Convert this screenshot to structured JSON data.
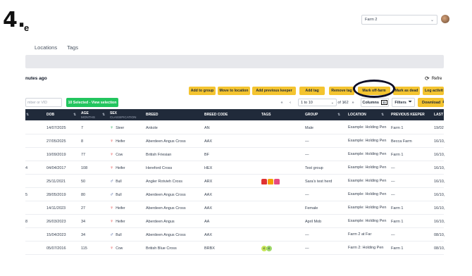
{
  "step": {
    "number": "4.",
    "title_fragment": "e"
  },
  "header": {
    "farm_select": "Farm 2"
  },
  "tabs": [
    "Locations",
    "Tags"
  ],
  "status": {
    "updated_text": "nutes ago",
    "refresh_label": "Refre"
  },
  "actions": {
    "add_to_group": "Add to group",
    "move_to_location": "Move to location",
    "add_previous_keeper": "Add previous keeper",
    "add_tag": "Add tag",
    "remove_tag": "Remove tag",
    "mark_off_farm": "Mark off-farm",
    "mark_as_dead": "Mark as dead",
    "log_activity": "Log activit"
  },
  "toolbar": {
    "search_placeholder": "mber or VID",
    "selection": "10 Selected - View selection",
    "first": "«",
    "prev": "‹",
    "page_range": "1 to 10",
    "page_of": "of 162",
    "next": "›",
    "last": "»",
    "columns": "Columns",
    "columns_badge": "11",
    "filters": "Filters",
    "download": "Download"
  },
  "table": {
    "headers": {
      "dob": "DOB",
      "age": "AGE",
      "age_sub": "MONTHS",
      "sex": "SEX",
      "sex_sub": "CLASSIFICATION",
      "breed": "BREED",
      "breed_code": "BREED CODE",
      "tags": "TAGS",
      "group": "GROUP",
      "location": "LOCATION",
      "previous_keeper": "PREVIOUS KEEPER",
      "last": "LAST"
    },
    "rows": [
      {
        "left": "",
        "dob": "14/07/2025",
        "age": "7",
        "sex": "Steer",
        "sex_type": "female",
        "breed": "Ankole",
        "code": "AN",
        "tags": [],
        "group": "Male",
        "location": "Example: Holding Pen",
        "keeper": "Farm 1",
        "last": "19/02"
      },
      {
        "left": "",
        "dob": "27/05/2025",
        "age": "8",
        "sex": "Heifer",
        "sex_type": "female",
        "breed": "Aberdeen Angus Cross",
        "code": "AAX",
        "tags": [],
        "group": "—",
        "location": "Example: Holding Pen",
        "keeper": "Becca Farm",
        "last": "16/10,"
      },
      {
        "left": "",
        "dob": "10/09/2019",
        "age": "77",
        "sex": "Cow",
        "sex_type": "female",
        "breed": "British Friesian",
        "code": "BF",
        "tags": [],
        "group": "—",
        "location": "Example: Holding Pen",
        "keeper": "Farm 1",
        "last": "16/10,"
      },
      {
        "left": "4",
        "dob": "04/04/2017",
        "age": "108",
        "sex": "Heifer",
        "sex_type": "female",
        "breed": "Hereford Cross",
        "code": "HEX",
        "tags": [],
        "group": "Test group",
        "location": "Example: Holding Pen",
        "keeper": "—",
        "last": "16/10,"
      },
      {
        "left": "",
        "dob": "25/11/2021",
        "age": "50",
        "sex": "Bull",
        "sex_type": "male",
        "breed": "Angler Rotvieh Cross",
        "code": "ARX",
        "tags": [
          "#e03131",
          "#f59f00",
          "#e64980"
        ],
        "group": "Sara's test herd",
        "location": "Example: Holding Pen",
        "keeper": "—",
        "last": "16/10,"
      },
      {
        "left": "5",
        "dob": "28/05/2019",
        "age": "80",
        "sex": "Bull",
        "sex_type": "male",
        "breed": "Aberdeen Angus Cross",
        "code": "AAX",
        "tags": [],
        "group": "—",
        "location": "Example: Holding Pen",
        "keeper": "—",
        "last": "16/10,"
      },
      {
        "left": "",
        "dob": "14/11/2023",
        "age": "27",
        "sex": "Heifer",
        "sex_type": "female",
        "breed": "Aberdeen Angus Cross",
        "code": "AAX",
        "tags": [],
        "group": "Female",
        "location": "Example: Holding Pen",
        "keeper": "Farm 1",
        "last": "16/10,"
      },
      {
        "left": "8",
        "dob": "26/03/2023",
        "age": "34",
        "sex": "Heifer",
        "sex_type": "female",
        "breed": "Aberdeen Angus",
        "code": "AA",
        "tags": [],
        "group": "April Mob",
        "location": "Example: Holding Pen",
        "keeper": "Farm 1",
        "last": "16/10,"
      },
      {
        "left": "",
        "dob": "15/04/2023",
        "age": "34",
        "sex": "Bull",
        "sex_type": "male",
        "breed": "Aberdeen Angus Cross",
        "code": "AAX",
        "tags": [],
        "group": "—",
        "location": "Farm 2 at Far",
        "keeper": "—",
        "last": "08/10,"
      },
      {
        "left": "",
        "dob": "05/07/2016",
        "age": "115",
        "sex": "Cow",
        "sex_type": "female",
        "breed": "British Blue Cross",
        "code": "BRBX",
        "tags": [
          "circleC",
          "circleC2"
        ],
        "group": "—",
        "location": "Farm 2: Holding Pen",
        "keeper": "Farm 1",
        "last": "08/10,"
      }
    ]
  },
  "colors": {
    "accent": "#f4c430",
    "header_bg": "#202a3a",
    "success": "#22c55e",
    "male": "#1e3a8a",
    "female": "#e03131",
    "steer": "#16a34a"
  }
}
